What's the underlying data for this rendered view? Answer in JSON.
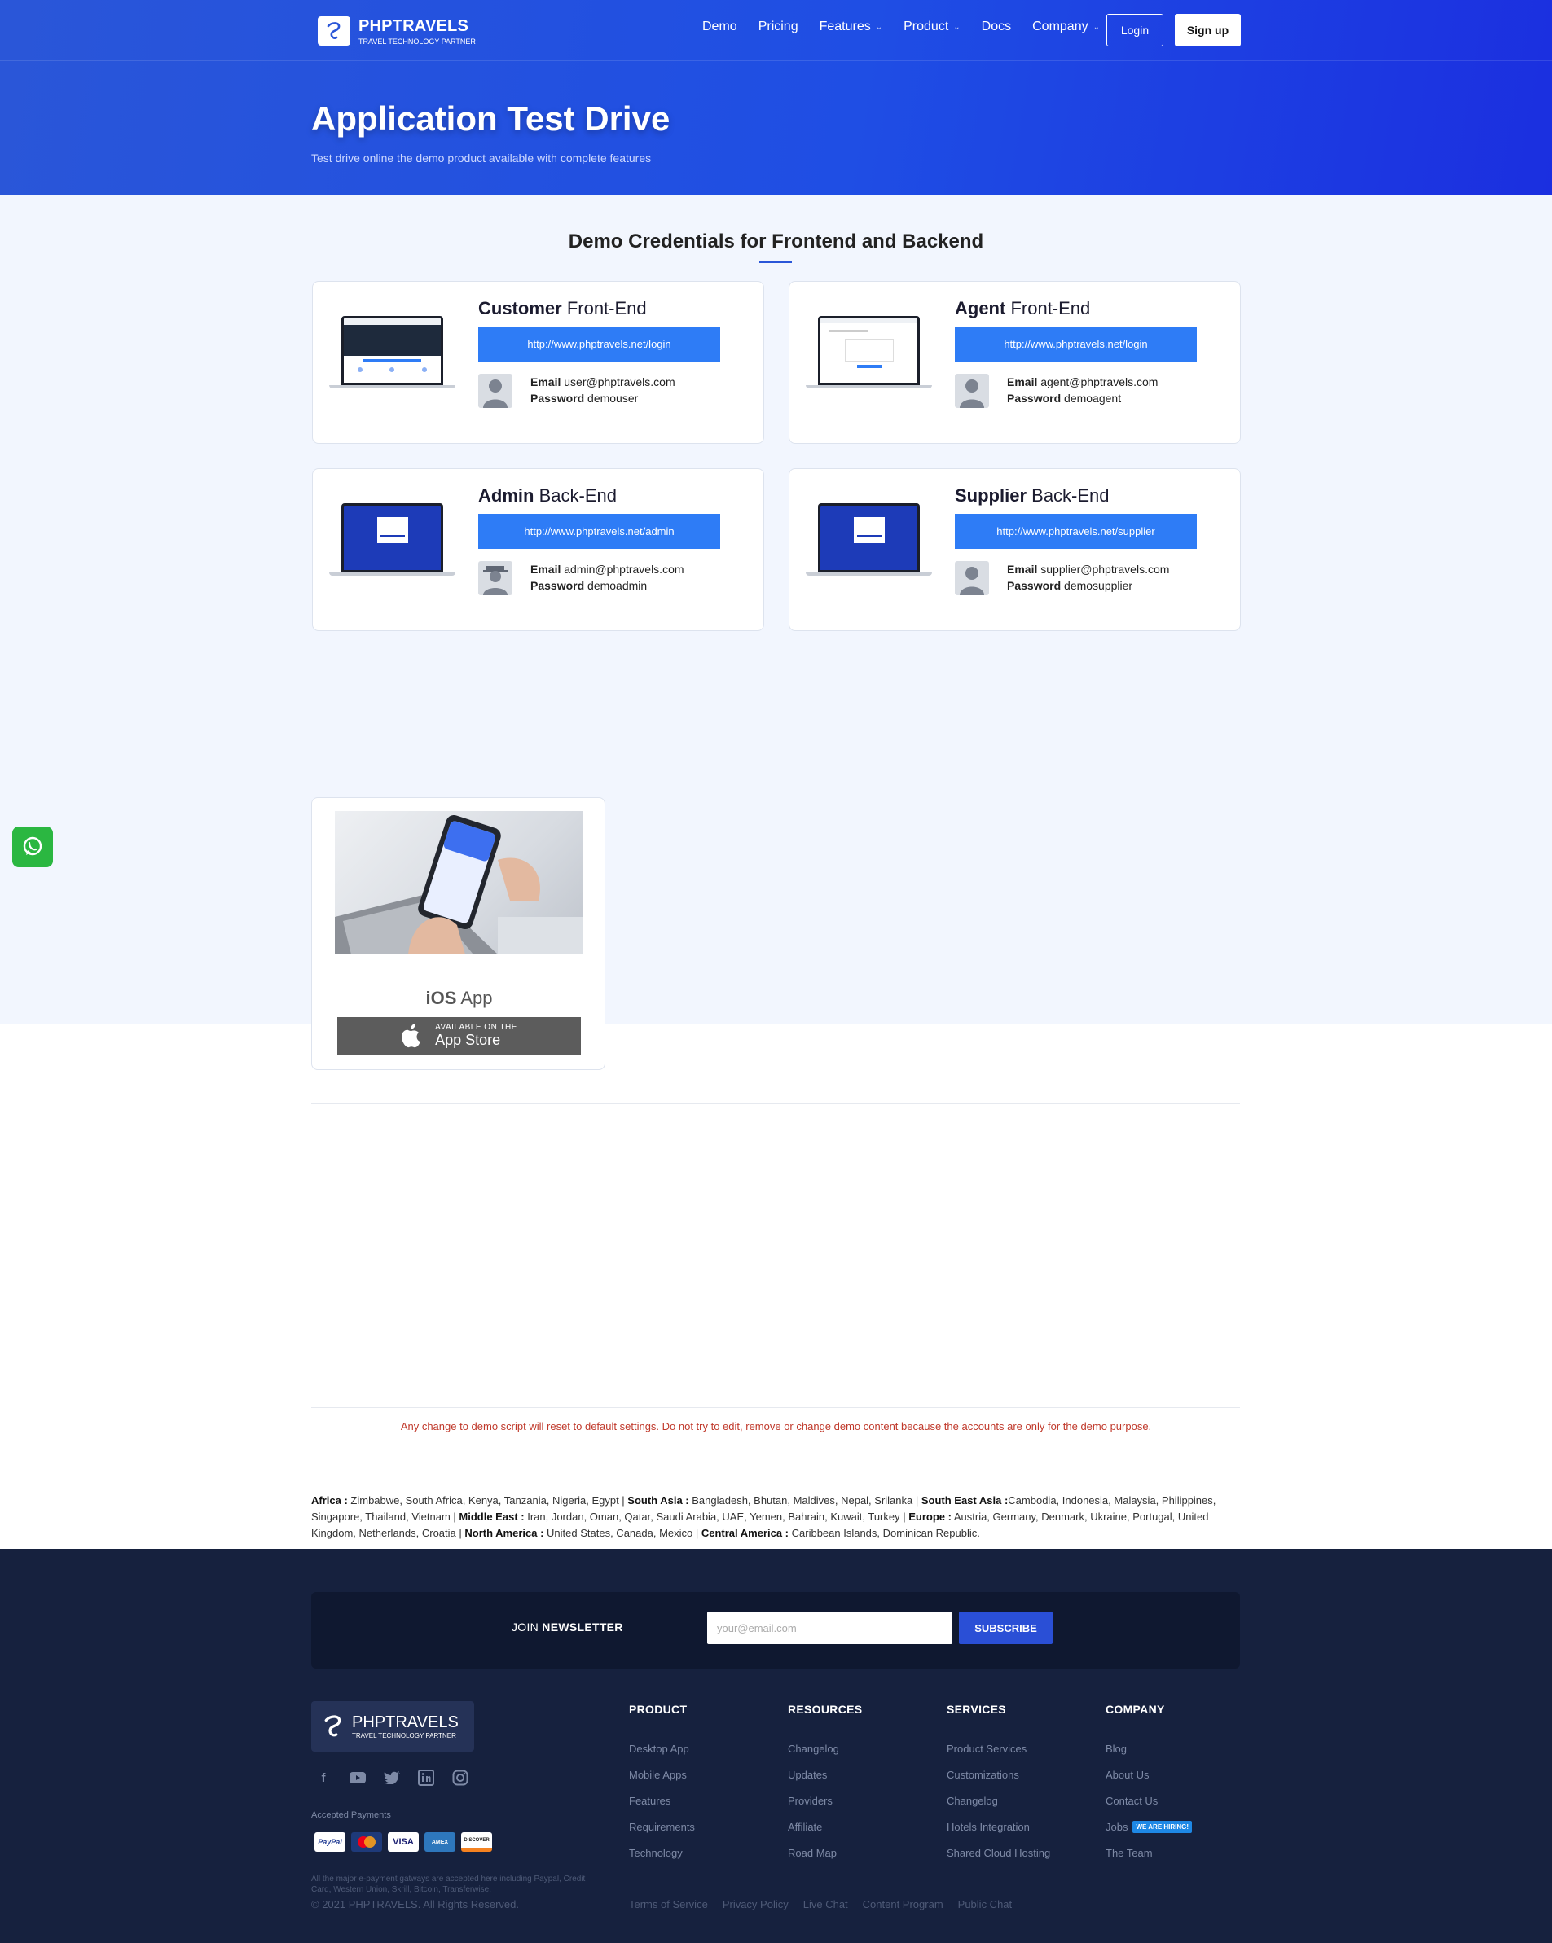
{
  "brand": {
    "name": "PHPTRAVELS",
    "tagline": "TRAVEL TECHNOLOGY PARTNER"
  },
  "nav": {
    "items": [
      {
        "label": "Demo",
        "dropdown": false
      },
      {
        "label": "Pricing",
        "dropdown": false
      },
      {
        "label": "Features",
        "dropdown": true
      },
      {
        "label": "Product",
        "dropdown": true
      },
      {
        "label": "Docs",
        "dropdown": false
      },
      {
        "label": "Company",
        "dropdown": true
      }
    ],
    "login_label": "Login",
    "signup_label": "Sign up"
  },
  "hero": {
    "title": "Application Test Drive",
    "subtitle": "Test drive online the demo product available with complete features"
  },
  "demo": {
    "section_title": "Demo Credentials for Frontend and Backend",
    "cards": [
      {
        "role": "Customer",
        "side": "Front-End",
        "url": "http://www.phptravels.net/login",
        "email_label": "Email",
        "email": "user@phptravels.com",
        "password_label": "Password",
        "password": "demouser"
      },
      {
        "role": "Agent",
        "side": "Front-End",
        "url": "http://www.phptravels.net/login",
        "email_label": "Email",
        "email": "agent@phptravels.com",
        "password_label": "Password",
        "password": "demoagent"
      },
      {
        "role": "Admin",
        "side": "Back-End",
        "url": "http://www.phptravels.net/admin",
        "email_label": "Email",
        "email": "admin@phptravels.com",
        "password_label": "Password",
        "password": "demoadmin"
      },
      {
        "role": "Supplier",
        "side": "Back-End",
        "url": "http://www.phptravels.net/supplier",
        "email_label": "Email",
        "email": "supplier@phptravels.com",
        "password_label": "Password",
        "password": "demosupplier"
      }
    ]
  },
  "app": {
    "title_bold": "iOS",
    "title_rest": "App",
    "store_small": "AVAILABLE ON THE",
    "store_large": "App Store"
  },
  "warning": "Any change to demo script will reset to default settings. Do not try to edit, remove or change demo content because the accounts are only for the demo purpose.",
  "regions": [
    {
      "name": "Africa :",
      "countries": " Zimbabwe, South Africa, Kenya, Tanzania, Nigeria, Egypt | "
    },
    {
      "name": "South Asia :",
      "countries": " Bangladesh, Bhutan, Maldives, Nepal, Srilanka | "
    },
    {
      "name": "South East Asia :",
      "countries": "Cambodia, Indonesia, Malaysia, Philippines, Singapore, Thailand, Vietnam | "
    },
    {
      "name": "Middle East :",
      "countries": " Iran, Jordan, Oman, Qatar, Saudi Arabia, UAE, Yemen, Bahrain, Kuwait, Turkey | "
    },
    {
      "name": "Europe :",
      "countries": " Austria, Germany, Denmark, Ukraine, Portugal, United Kingdom, Netherlands, Croatia | "
    },
    {
      "name": "North America :",
      "countries": " United States, Canada, Mexico | "
    },
    {
      "name": "Central America :",
      "countries": " Caribbean Islands, Dominican Republic."
    }
  ],
  "newsletter": {
    "label_light": "JOIN ",
    "label_bold": "NEWSLETTER",
    "placeholder": "your@email.com",
    "button": "SUBSCRIBE"
  },
  "footer": {
    "accepted_label": "Accepted Payments",
    "payments": [
      "PayPal",
      "MasterCard",
      "VISA",
      "AMEX",
      "DISCOVER"
    ],
    "note": "All the major e-payment gatways are accepted here including Paypal, Credit Card, Western Union, Skrill, Bitcoin, Transferwise.",
    "copyright": "© 2021 PHPTRAVELS. All Rights Reserved.",
    "social_icons": [
      "facebook-icon",
      "youtube-icon",
      "twitter-icon",
      "linkedin-icon",
      "instagram-icon"
    ],
    "columns": [
      {
        "heading": "PRODUCT",
        "links": [
          "Desktop App",
          "Mobile Apps",
          "Features",
          "Requirements",
          "Technology"
        ]
      },
      {
        "heading": "RESOURCES",
        "links": [
          "Changelog",
          "Updates",
          "Providers",
          "Affiliate",
          "Road Map"
        ]
      },
      {
        "heading": "SERVICES",
        "links": [
          "Product Services",
          "Customizations",
          "Changelog",
          "Hotels Integration",
          "Shared Cloud Hosting"
        ]
      },
      {
        "heading": "COMPANY",
        "links": [
          "Blog",
          "About Us",
          "Contact Us",
          "Jobs",
          "The Team"
        ],
        "badge": "WE ARE HIRING!"
      }
    ],
    "legal": [
      "Terms of Service",
      "Privacy Policy",
      "Live Chat",
      "Content Program",
      "Public Chat"
    ]
  },
  "colors": {
    "primary": "#2a56d8",
    "url_button": "#2e7cf6",
    "footer_bg": "#16213e",
    "warning": "#c0392b",
    "whatsapp": "#2bb741"
  }
}
